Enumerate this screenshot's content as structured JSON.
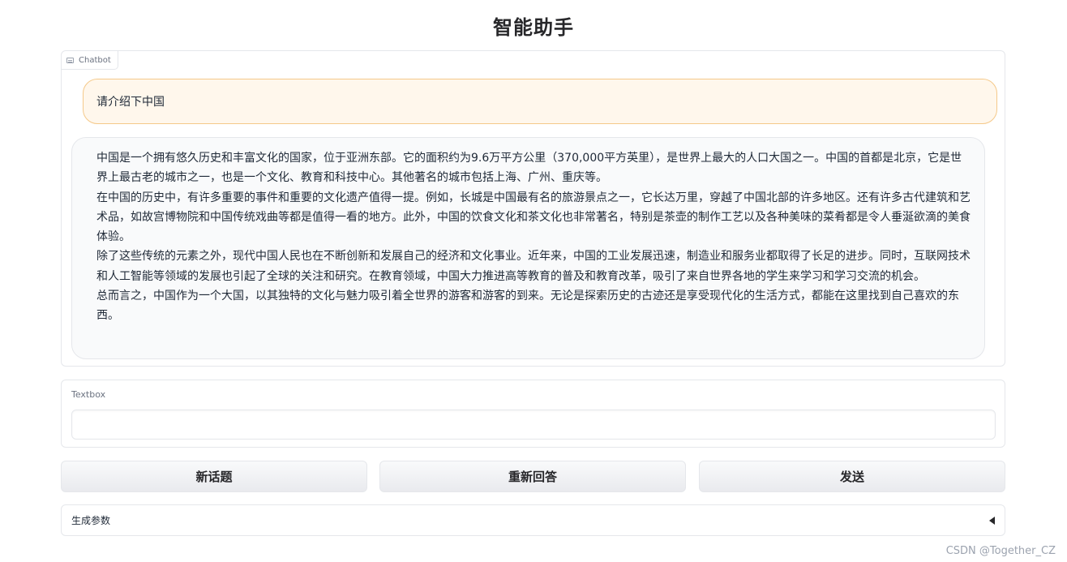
{
  "app": {
    "title": "智能助手"
  },
  "chatbot": {
    "label": "Chatbot",
    "user_message": "请介绍下中国",
    "bot_paragraphs": [
      "中国是一个拥有悠久历史和丰富文化的国家，位于亚洲东部。它的面积约为9.6万平方公里（370,000平方英里），是世界上最大的人口大国之一。中国的首都是北京，它是世界上最古老的城市之一，也是一个文化、教育和科技中心。其他著名的城市包括上海、广州、重庆等。",
      "在中国的历史中，有许多重要的事件和重要的文化遗产值得一提。例如，长城是中国最有名的旅游景点之一，它长达万里，穿越了中国北部的许多地区。还有许多古代建筑和艺术品，如故宫博物院和中国传统戏曲等都是值得一看的地方。此外，中国的饮食文化和茶文化也非常著名，特别是茶壶的制作工艺以及各种美味的菜肴都是令人垂涎欲滴的美食体验。",
      "除了这些传统的元素之外，现代中国人民也在不断创新和发展自己的经济和文化事业。近年来，中国的工业发展迅速，制造业和服务业都取得了长足的进步。同时，互联网技术和人工智能等领域的发展也引起了全球的关注和研究。在教育领域，中国大力推进高等教育的普及和教育改革，吸引了来自世界各地的学生来学习和学习交流的机会。",
      "总而言之，中国作为一个大国，以其独特的文化与魅力吸引着全世界的游客和游客的到来。无论是探索历史的古迹还是享受现代化的生活方式，都能在这里找到自己喜欢的东西。"
    ]
  },
  "textbox": {
    "label": "Textbox",
    "value": "",
    "placeholder": ""
  },
  "buttons": {
    "new_topic": "新话题",
    "regenerate": "重新回答",
    "send": "发送"
  },
  "accordion": {
    "label": "生成参数",
    "expanded": false
  },
  "watermark": "CSDN @Together_CZ",
  "icons": {
    "chatbot_label_icon": "chat-bubble-icon",
    "accordion_icon": "caret-left-icon"
  }
}
